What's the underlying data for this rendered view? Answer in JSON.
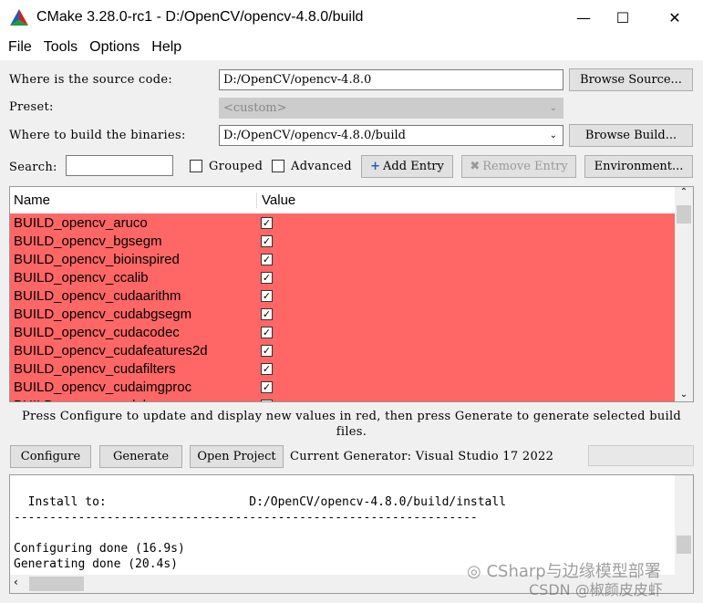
{
  "window": {
    "title": "CMake 3.28.0-rc1 - D:/OpenCV/opencv-4.8.0/build",
    "minimize": "—",
    "maximize": "☐",
    "close": "✕"
  },
  "menu": [
    "File",
    "Tools",
    "Options",
    "Help"
  ],
  "source": {
    "label": "Where is the source code:",
    "value": "D:/OpenCV/opencv-4.8.0",
    "browse": "Browse Source..."
  },
  "preset": {
    "label": "Preset:",
    "value": "<custom>"
  },
  "build": {
    "label": "Where to build the binaries:",
    "value": "D:/OpenCV/opencv-4.8.0/build",
    "browse": "Browse Build..."
  },
  "search": {
    "label": "Search:",
    "value": ""
  },
  "options": {
    "grouped": "Grouped",
    "advanced": "Advanced",
    "add_entry": "Add Entry",
    "remove_entry": "Remove Entry",
    "environment": "Environment..."
  },
  "table": {
    "headers": [
      "Name",
      "Value"
    ],
    "rows": [
      "BUILD_opencv_aruco",
      "BUILD_opencv_bgsegm",
      "BUILD_opencv_bioinspired",
      "BUILD_opencv_ccalib",
      "BUILD_opencv_cudaarithm",
      "BUILD_opencv_cudabgsegm",
      "BUILD_opencv_cudacodec",
      "BUILD_opencv_cudafeatures2d",
      "BUILD_opencv_cudafilters",
      "BUILD_opencv_cudaimgproc",
      "BUILD_opencv_cudalegacy"
    ]
  },
  "hint": "Press Configure to update and display new values in red, then press Generate to generate selected build files.",
  "actions": {
    "configure": "Configure",
    "generate": "Generate",
    "open_project": "Open Project",
    "generator": "Current Generator: Visual Studio 17 2022"
  },
  "output": {
    "lines": [
      "",
      "  Install to:                    D:/OpenCV/opencv-4.8.0/build/install",
      "-----------------------------------------------------------------",
      "",
      "Configuring done (16.9s)",
      "Generating done (20.4s)"
    ]
  },
  "watermark": {
    "line1": "CSharp与边缘模型部署",
    "line2": "CSDN @椒颜皮皮虾"
  },
  "colors": {
    "changed_row": "#ff6666"
  }
}
